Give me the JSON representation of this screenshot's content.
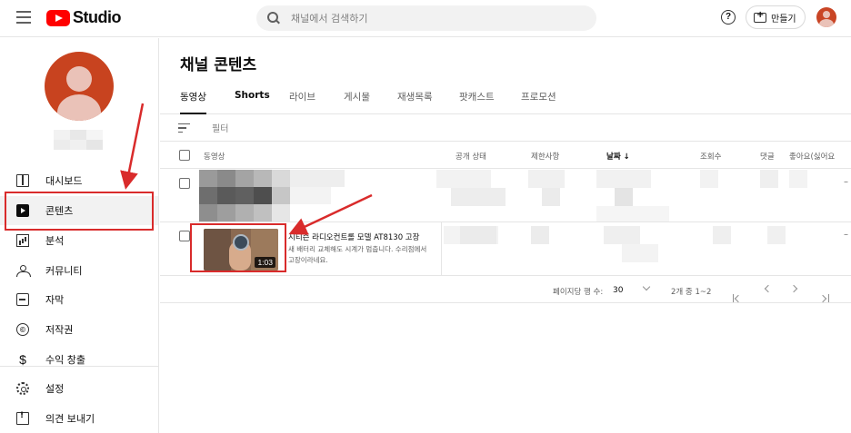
{
  "header": {
    "app_name": "Studio",
    "search_placeholder": "채널에서 검색하기",
    "help_symbol": "?",
    "create_label": "만들기"
  },
  "sidebar": {
    "items": [
      {
        "label": "대시보드",
        "icon": "dashboard-icon"
      },
      {
        "label": "콘텐츠",
        "icon": "content-icon",
        "active": true
      },
      {
        "label": "분석",
        "icon": "analytics-icon"
      },
      {
        "label": "커뮤니티",
        "icon": "community-icon"
      },
      {
        "label": "자막",
        "icon": "subtitles-icon"
      },
      {
        "label": "저작권",
        "icon": "copyright-icon"
      },
      {
        "label": "수익 창출",
        "icon": "monetization-icon"
      },
      {
        "label": "설정",
        "icon": "settings-icon"
      },
      {
        "label": "의견 보내기",
        "icon": "feedback-icon"
      }
    ],
    "copyright_symbol": "©",
    "money_symbol": "$"
  },
  "main": {
    "title": "채널 콘텐츠",
    "tabs": [
      "동영상",
      "Shorts",
      "라이브",
      "게시물",
      "재생목록",
      "팟캐스트",
      "프로모션"
    ],
    "filter_label": "필터",
    "columns": [
      "동영상",
      "공개 상태",
      "제한사항",
      "날짜 ↓",
      "조회수",
      "댓글",
      "좋아요(싫어요"
    ],
    "rows": [
      {
        "empty_value": "–"
      },
      {
        "duration": "1:03",
        "title": "시티즌 라디오컨트롤 모델 AT8130 고장",
        "description": "새 배터리 교체해도 시계가 멈춥니다. 수리점에서 고장이라네요.",
        "empty_value": "–"
      }
    ],
    "pagination": {
      "rows_per_page_label": "페이지당 행 수:",
      "rows_per_page": "30",
      "range": "2개 중 1~2"
    }
  },
  "colors": {
    "brand_red": "#ff0000",
    "annotation_red": "#d92b2b",
    "avatar": "#c8431f"
  }
}
